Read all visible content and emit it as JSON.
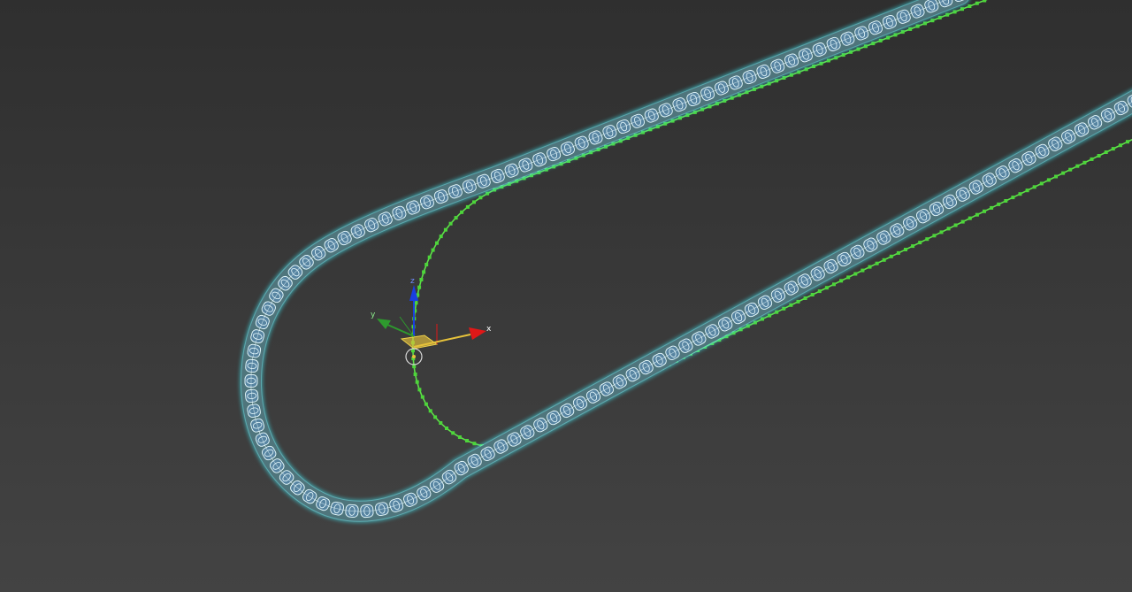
{
  "viewport": {
    "background_top": "#2f2f2f",
    "background_bottom": "#434343"
  },
  "chain": {
    "wire_color": "#e8fbff",
    "glow_color": "#3fe6f2",
    "fill_color": "#5f8fbf"
  },
  "path_spline": {
    "color": "#5fe04a",
    "vertex_color": "#4dd63a"
  },
  "gizmo": {
    "x_label": "x",
    "y_label": "y",
    "z_label": "z",
    "x_color": "#e01818",
    "y_color": "#2e9a2e",
    "z_color": "#1a3fe0",
    "plane_color": "#e6c23a"
  }
}
